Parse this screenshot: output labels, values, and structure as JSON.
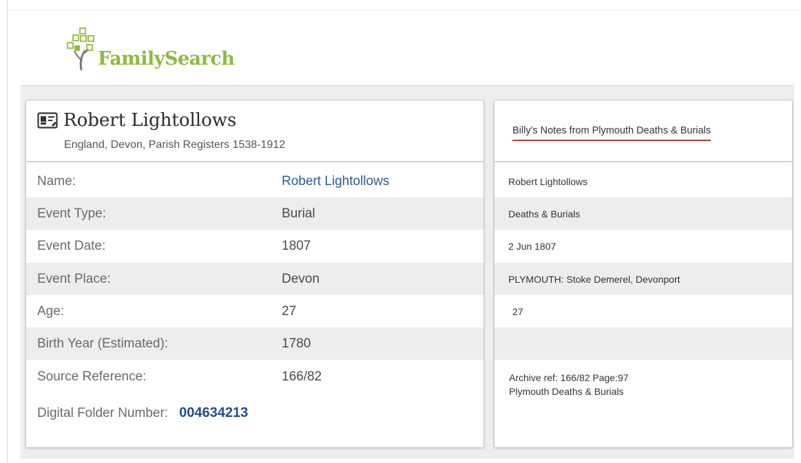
{
  "logo": {
    "text": "FamilySearch",
    "color": "#8dbb3d"
  },
  "record": {
    "name": "Robert Lightollows",
    "collection": "England, Devon, Parish Registers 1538-1912",
    "fields": [
      {
        "label": "Name:",
        "value": "Robert Lightollows"
      },
      {
        "label": "Event Type:",
        "value": "Burial"
      },
      {
        "label": "Event Date:",
        "value": "1807"
      },
      {
        "label": "Event Place:",
        "value": "Devon"
      },
      {
        "label": "Age:",
        "value": "27"
      },
      {
        "label": "Birth Year (Estimated):",
        "value": "1780"
      },
      {
        "label": "Source Reference:",
        "value": "166/82"
      }
    ],
    "digital_folder": {
      "label": "Digital Folder Number:",
      "value": "004634213"
    }
  },
  "notes": {
    "title": "Billy's Notes from Plymouth Deaths & Burials",
    "rows": [
      "Robert Lightollows",
      "Deaths & Burials",
      "2 Jun 1807",
      "PLYMOUTH: Stoke Demerel, Devonport",
      "27",
      ""
    ],
    "source_line1": "Archive ref: 166/82  Page:97",
    "source_line2": "Plymouth Deaths & Burials"
  },
  "colors": {
    "link": "#2c5b8f",
    "folder_number": "#1f4e8c",
    "underline": "#c0392b",
    "shade": "#ededed"
  },
  "icons": {
    "record": "record-card-icon",
    "logo": "family-tree-icon"
  }
}
